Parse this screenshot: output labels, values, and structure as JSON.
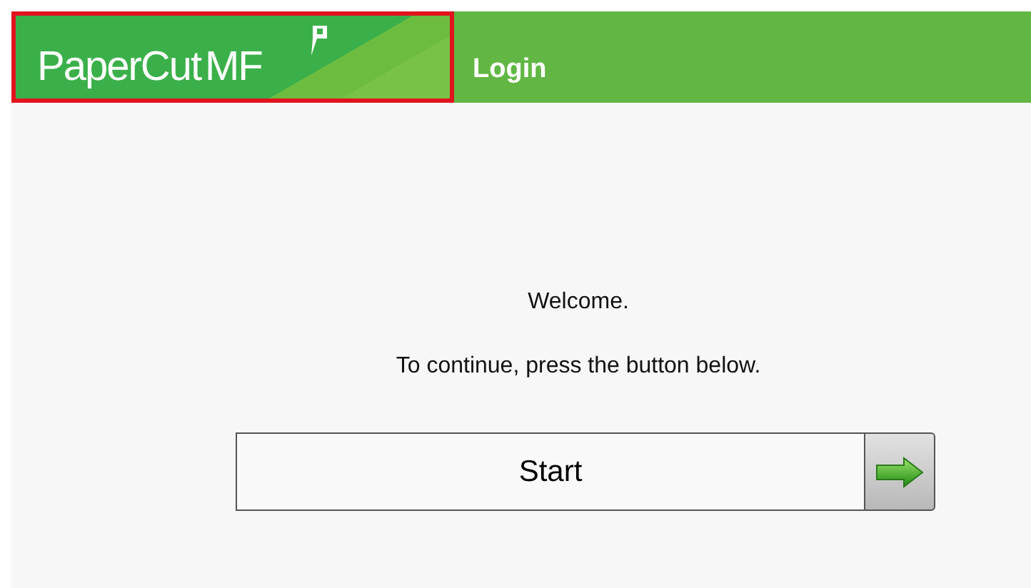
{
  "header": {
    "logo": {
      "brand": "PaperCut",
      "product": "MF",
      "highlighted": true
    },
    "title": "Login"
  },
  "message": {
    "lines": [
      "Welcome.",
      "To continue, press the button below."
    ]
  },
  "start_button": {
    "label": "Start"
  }
}
